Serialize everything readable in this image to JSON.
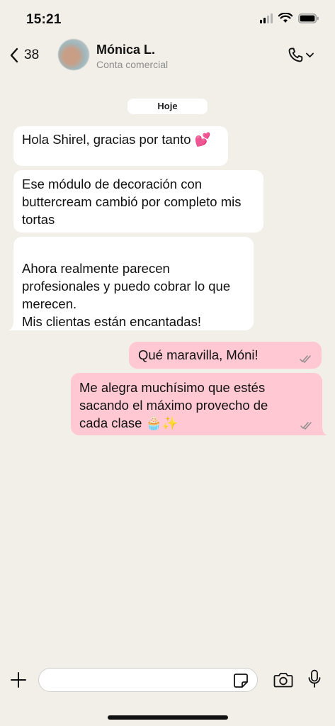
{
  "status_bar": {
    "time": "15:21"
  },
  "header": {
    "back_count": "38",
    "contact_name": "Mónica L.",
    "contact_subtitle": "Conta comercial"
  },
  "date_label": "Hoje",
  "messages": [
    {
      "direction": "in",
      "text": "Hola Shirel, gracias por tanto 💕"
    },
    {
      "direction": "in",
      "text": "Ese módulo de decoración con buttercream cambió por completo mis tortas"
    },
    {
      "direction": "in",
      "text": "Ahora realmente parecen profesionales y puedo cobrar lo que merecen.\nMis clientas están encantadas!"
    },
    {
      "direction": "out",
      "text": "Qué maravilla, Móni!"
    },
    {
      "direction": "out",
      "text": "Me alegra muchísimo que estés sacando el máximo provecho de cada clase 🧁✨"
    }
  ],
  "composer": {
    "placeholder": ""
  },
  "colors": {
    "background": "#f2efe8",
    "incoming_bubble": "#ffffff",
    "outgoing_bubble": "#ffc8d3"
  },
  "icons": [
    "back-chevron-icon",
    "phone-icon",
    "chevron-down-icon",
    "plus-icon",
    "sticker-icon",
    "camera-icon",
    "microphone-icon",
    "double-check-icon"
  ]
}
